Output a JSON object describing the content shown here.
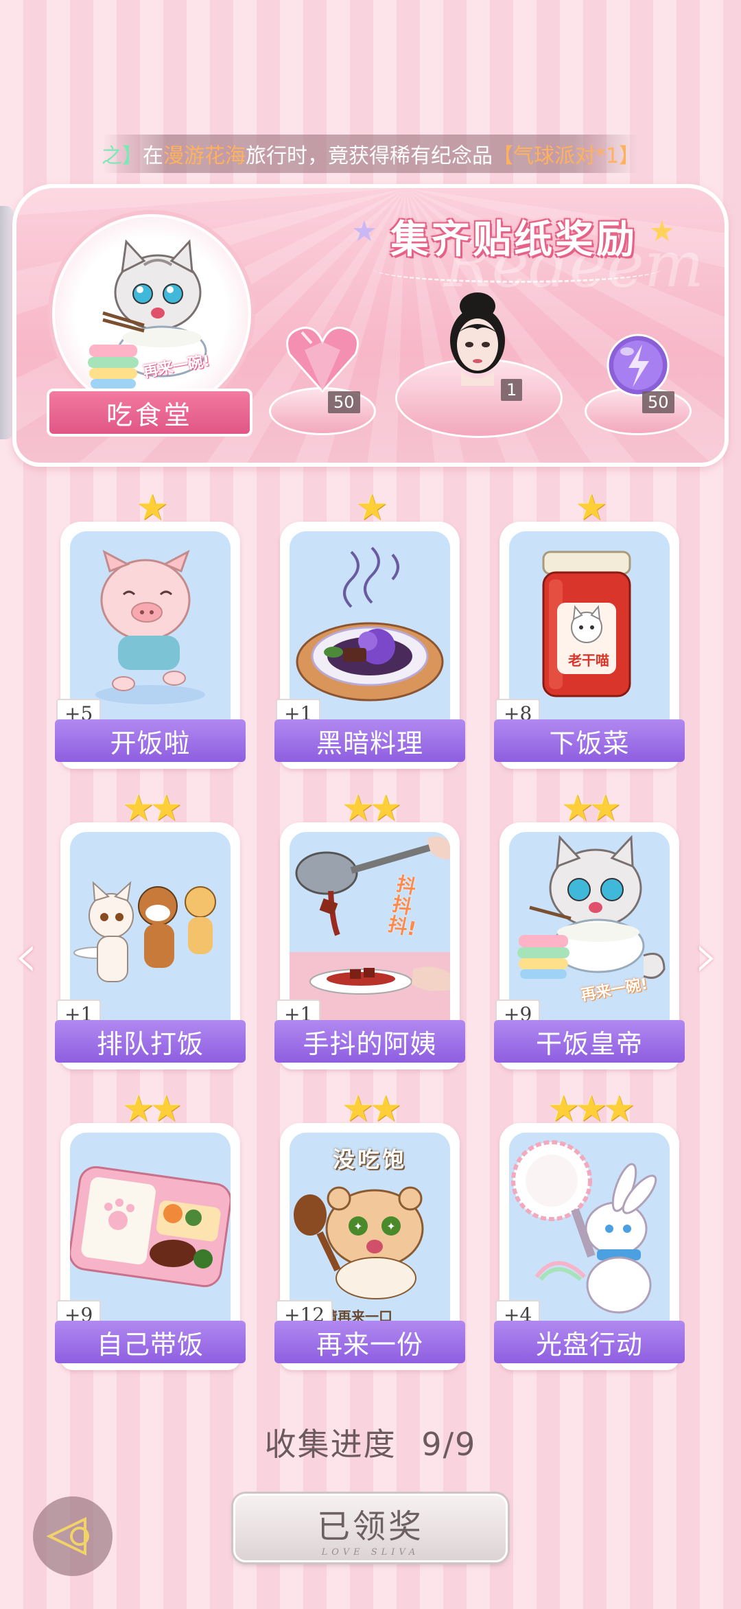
{
  "ticker": {
    "prefix": "之】",
    "text1": "在",
    "location": "漫游花海",
    "text2": "旅行时，竟获得稀有纪念品",
    "item": "【气球派对*1】"
  },
  "banner": {
    "title": "集齐贴纸奖励",
    "watermark": "Redeem",
    "badge_label": "吃食堂",
    "badge_caption": "再来一碗!",
    "rewards": [
      {
        "icon": "pink-heart-gem-icon",
        "count": "50"
      },
      {
        "icon": "female-portrait-icon",
        "count": "1"
      },
      {
        "icon": "purple-lightning-orb-icon",
        "count": "50"
      }
    ]
  },
  "stickers": [
    {
      "name": "开饭啦",
      "plus": "+5",
      "stars": "★",
      "icon": "running-pig-icon"
    },
    {
      "name": "黑暗料理",
      "plus": "+1",
      "stars": "★",
      "icon": "dark-cuisine-plate-icon"
    },
    {
      "name": "下饭菜",
      "plus": "+8",
      "stars": "★",
      "icon": "chili-jar-icon",
      "jar_text": "老干喵"
    },
    {
      "name": "排队打饭",
      "plus": "+1",
      "stars": "★★",
      "icon": "queue-cats-icon"
    },
    {
      "name": "手抖的阿姨",
      "plus": "+1",
      "stars": "★★",
      "icon": "ladle-pour-icon",
      "caption": "抖抖抖!"
    },
    {
      "name": "干饭皇帝",
      "plus": "+9",
      "stars": "★★",
      "icon": "cat-eating-rice-icon",
      "caption": "再来一碗!"
    },
    {
      "name": "自己带饭",
      "plus": "+9",
      "stars": "★★",
      "icon": "bento-box-icon"
    },
    {
      "name": "再来一份",
      "plus": "+12",
      "stars": "★★",
      "icon": "hamster-spoon-icon",
      "caption_top": "没吃饱",
      "caption_bottom": "请再来一口"
    },
    {
      "name": "光盘行动",
      "plus": "+4",
      "stars": "★★★",
      "icon": "bunny-plate-icon"
    }
  ],
  "progress": {
    "label": "收集进度",
    "value": "9/9"
  },
  "claim_button": {
    "label": "已领奖",
    "sub": "LOVE SLIVA"
  },
  "colors": {
    "accent_pink": "#e05685",
    "label_purple": "#8e5ee0",
    "art_blue": "#c9e2fa"
  }
}
